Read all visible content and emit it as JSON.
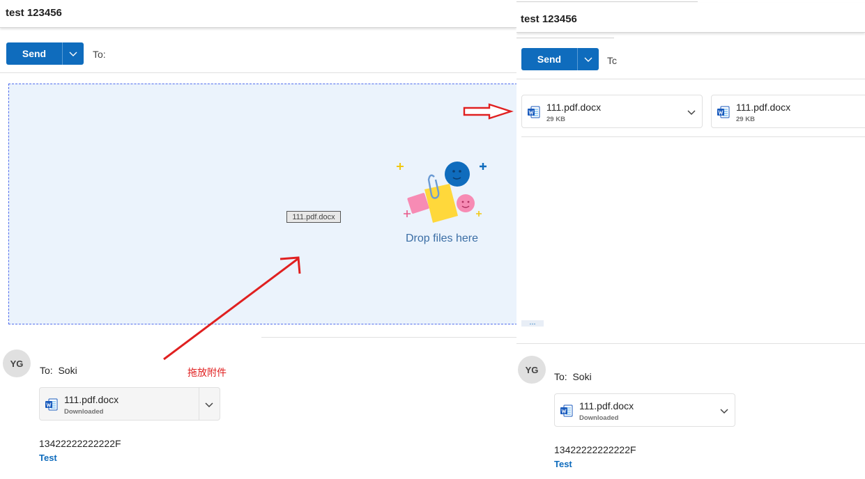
{
  "left": {
    "subject": "test 123456",
    "send_label": "Send",
    "to_label": "To:",
    "drag_chip_label": "111.pdf.docx",
    "drop_text": "Drop files here",
    "message": {
      "avatar_initials": "YG",
      "recipients_label": "To:",
      "recipients": "Soki",
      "attachment": {
        "name": "111.pdf.docx",
        "status": "Downloaded"
      },
      "body": "13422222222222F",
      "signature": "Test"
    }
  },
  "right": {
    "subject": "test 123456",
    "send_label": "Send",
    "to_label": "Tc",
    "attachments": [
      {
        "name": "111.pdf.docx",
        "size": "29 KB"
      },
      {
        "name": "111.pdf.docx",
        "size": "29 KB"
      }
    ],
    "ellipsis": "...",
    "message": {
      "avatar_initials": "YG",
      "recipients_label": "To:",
      "recipients": "Soki",
      "attachment": {
        "name": "111.pdf.docx",
        "status": "Downloaded"
      },
      "body": "13422222222222F",
      "signature": "Test"
    }
  },
  "annotation": {
    "label": "拖放附件",
    "arrow_color": "#e02020"
  },
  "colors": {
    "accent": "#0f6cbd",
    "dropzone_bg": "#ebf3fc",
    "word_icon": "#185abd"
  },
  "icons": {
    "send_dropdown": "chevron-down-icon",
    "attachment_type": "word-document-icon",
    "attachment_menu": "chevron-down-icon"
  }
}
